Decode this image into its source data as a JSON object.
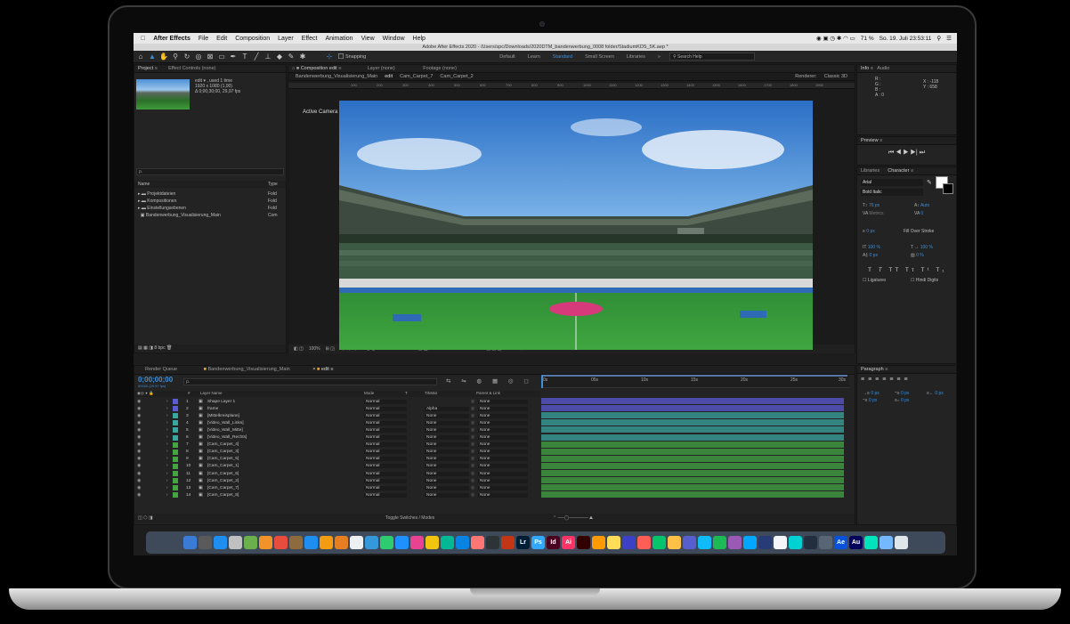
{
  "menubar": {
    "app_name": "After Effects",
    "items": [
      "File",
      "Edit",
      "Composition",
      "Layer",
      "Effect",
      "Animation",
      "View",
      "Window",
      "Help"
    ],
    "battery": "71 %",
    "datetime": "So. 19. Juli  23:53:11"
  },
  "titlebar": {
    "text": "Adobe After Effects 2020 - /Users/spc/Downloads/2020DTM_bandenwerbung_0008 folder/StadiumKDS_5K.aep *"
  },
  "toolbar": {
    "snapping": "Snapping",
    "workspaces": [
      "Default",
      "Learn",
      "Standard",
      "Small Screen",
      "Libraries"
    ],
    "active_workspace": "Standard",
    "search_placeholder": "Search Help"
  },
  "project": {
    "tab_project": "Project",
    "tab_effect": "Effect Controls (none)",
    "item_name": "edit ▾ , used 1 time",
    "item_res": "1920 x 1080 (1,00)",
    "item_dur": "Δ 0;00;30;00, 29,97 fps",
    "search_placeholder": "ρ.",
    "col_name": "Name",
    "col_type": "Type",
    "rows": [
      {
        "name": "Projektdateien",
        "type": "Fold"
      },
      {
        "name": "Kompositionen",
        "type": "Fold"
      },
      {
        "name": "Einstellungsebenen",
        "type": "Fold"
      },
      {
        "name": "Bandenwerbung_Visualisierung_Main",
        "type": "Com"
      }
    ],
    "bpc": "8 bpc"
  },
  "composition": {
    "tab_comp": "Composition edit",
    "tab_layer": "Layer (none)",
    "tab_footage": "Footage (none)",
    "crumbs": [
      "Bandenwerbung_Visualisierung_Main",
      "edit",
      "Cam_Carpet_7",
      "Cam_Carpet_2"
    ],
    "renderer": "Renderer:",
    "renderer_val": "Classic 3D",
    "view_label": "Active Camera",
    "zoom": "100%",
    "timecode": "0;00;00;00",
    "resolution": "Full",
    "camera": "Active Camera",
    "views": "1 View",
    "exposure": "+0,0"
  },
  "ruler_ticks": [
    "100",
    "200",
    "300",
    "400",
    "500",
    "600",
    "700",
    "800",
    "900",
    "1000",
    "1100",
    "1200",
    "1300",
    "1400",
    "1500",
    "1600",
    "1700",
    "1800",
    "1900"
  ],
  "info": {
    "tab_info": "Info",
    "tab_audio": "Audio",
    "r": "R :",
    "g": "G :",
    "b": "B :",
    "a": "A : 0",
    "x": "X : -118",
    "y": "Y : 658"
  },
  "preview": {
    "tab": "Preview"
  },
  "character": {
    "tab_libraries": "Libraries",
    "tab_character": "Character",
    "font": "Arial",
    "style": "Bold Italic",
    "size": "76 px",
    "leading": "Auto",
    "tracking": "0",
    "kerning": "Metrics",
    "stroke": "0 px",
    "stroke_type": "Fill Over Stroke",
    "vscale": "100 %",
    "hscale": "100 %",
    "baseline": "0 px",
    "tsume": "0 %",
    "ligatures": "Ligatures",
    "hindi": "Hindi Digits"
  },
  "paragraph": {
    "tab": "Paragraph",
    "indent1": "0 px",
    "indent2": "0 px",
    "indent3": "0 px",
    "space1": "0 px",
    "space2": "0 px"
  },
  "timeline": {
    "tab_render": "Render Queue",
    "tab_main": "Bandenwerbung_Visualisierung_Main",
    "tab_edit": "edit",
    "timecode": "0;00;00;00",
    "fps_line": "00000 (29.97 fps)",
    "col_num": "#",
    "col_layer": "Layer Name",
    "col_mode": "Mode",
    "col_t": "T",
    "col_trkmat": "TrkMat",
    "col_parent": "Parent & Link",
    "ticks": [
      "0s",
      "05s",
      "10s",
      "15s",
      "20s",
      "25s",
      "30s"
    ],
    "toggle": "Toggle Switches / Modes",
    "layers": [
      {
        "num": "1",
        "name": "Shape Layer 1",
        "mode": "Normal",
        "trk": "",
        "parent": "None",
        "color": "#5b5bd6"
      },
      {
        "num": "2",
        "name": "frame",
        "mode": "Normal",
        "trk": "Alpha",
        "parent": "None",
        "color": "#5b5bd6"
      },
      {
        "num": "3",
        "name": "[Mittelkreisplane]",
        "mode": "Normal",
        "trk": "None",
        "parent": "None",
        "color": "#3aa6a0"
      },
      {
        "num": "4",
        "name": "[Video_Wall_Links]",
        "mode": "Normal",
        "trk": "None",
        "parent": "None",
        "color": "#3aa6a0"
      },
      {
        "num": "5",
        "name": "[Video_Wall_Mitte]",
        "mode": "Normal",
        "trk": "None",
        "parent": "None",
        "color": "#3aa6a0"
      },
      {
        "num": "6",
        "name": "[Video_Wall_Rechts]",
        "mode": "Normal",
        "trk": "None",
        "parent": "None",
        "color": "#3aa6a0"
      },
      {
        "num": "7",
        "name": "[Cam_Carpet_4]",
        "mode": "Normal",
        "trk": "None",
        "parent": "None",
        "color": "#44a546"
      },
      {
        "num": "8",
        "name": "[Cam_Carpet_3]",
        "mode": "Normal",
        "trk": "None",
        "parent": "None",
        "color": "#44a546"
      },
      {
        "num": "9",
        "name": "[Cam_Carpet_5]",
        "mode": "Normal",
        "trk": "None",
        "parent": "None",
        "color": "#44a546"
      },
      {
        "num": "10",
        "name": "[Cam_Carpet_1]",
        "mode": "Normal",
        "trk": "None",
        "parent": "None",
        "color": "#44a546"
      },
      {
        "num": "11",
        "name": "[Cam_Carpet_6]",
        "mode": "Normal",
        "trk": "None",
        "parent": "None",
        "color": "#44a546"
      },
      {
        "num": "12",
        "name": "[Cam_Carpet_2]",
        "mode": "Normal",
        "trk": "None",
        "parent": "None",
        "color": "#44a546"
      },
      {
        "num": "13",
        "name": "[Cam_Carpet_7]",
        "mode": "Normal",
        "trk": "None",
        "parent": "None",
        "color": "#44a546"
      },
      {
        "num": "14",
        "name": "[Cam_Carpet_8]",
        "mode": "Normal",
        "trk": "None",
        "parent": "None",
        "color": "#44a546"
      }
    ]
  },
  "dock": {
    "lr": "Lr",
    "ps": "Ps",
    "id": "Id",
    "ai": "Ai",
    "ae": "Ae",
    "au": "Au",
    "colors": [
      "#3a7bd5",
      "#5a5a5a",
      "#1f8ef1",
      "#c0c0c0",
      "#6ab04c",
      "#f0932b",
      "#e74c3c",
      "#8e6b3e",
      "#1f8ef1",
      "#f39c12",
      "#e67e22",
      "#ecf0f1",
      "#3498db",
      "#2ecc71",
      "#1e90ff",
      "#e84393",
      "#f1c40f",
      "#00b894",
      "#0984e3",
      "#ff7675",
      "#2d3436",
      "#c23616",
      "#001e36",
      "#31a8ff",
      "#49021f",
      "#ff3366",
      "#330000",
      "#ff9a00",
      "#ffdd59",
      "#3c40c6",
      "#ff5e57",
      "#05c46b",
      "#ffc048",
      "#575fcf",
      "#0fbcf9",
      "#1db954",
      "#9b59b6",
      "#00a8ff",
      "#273c75",
      "#f5f6fa",
      "#00d2d3",
      "#222f3e",
      "#576574",
      "#0652dd",
      "#00005b",
      "#00e4bb",
      "#74b9ff",
      "#dfe6e9"
    ]
  }
}
